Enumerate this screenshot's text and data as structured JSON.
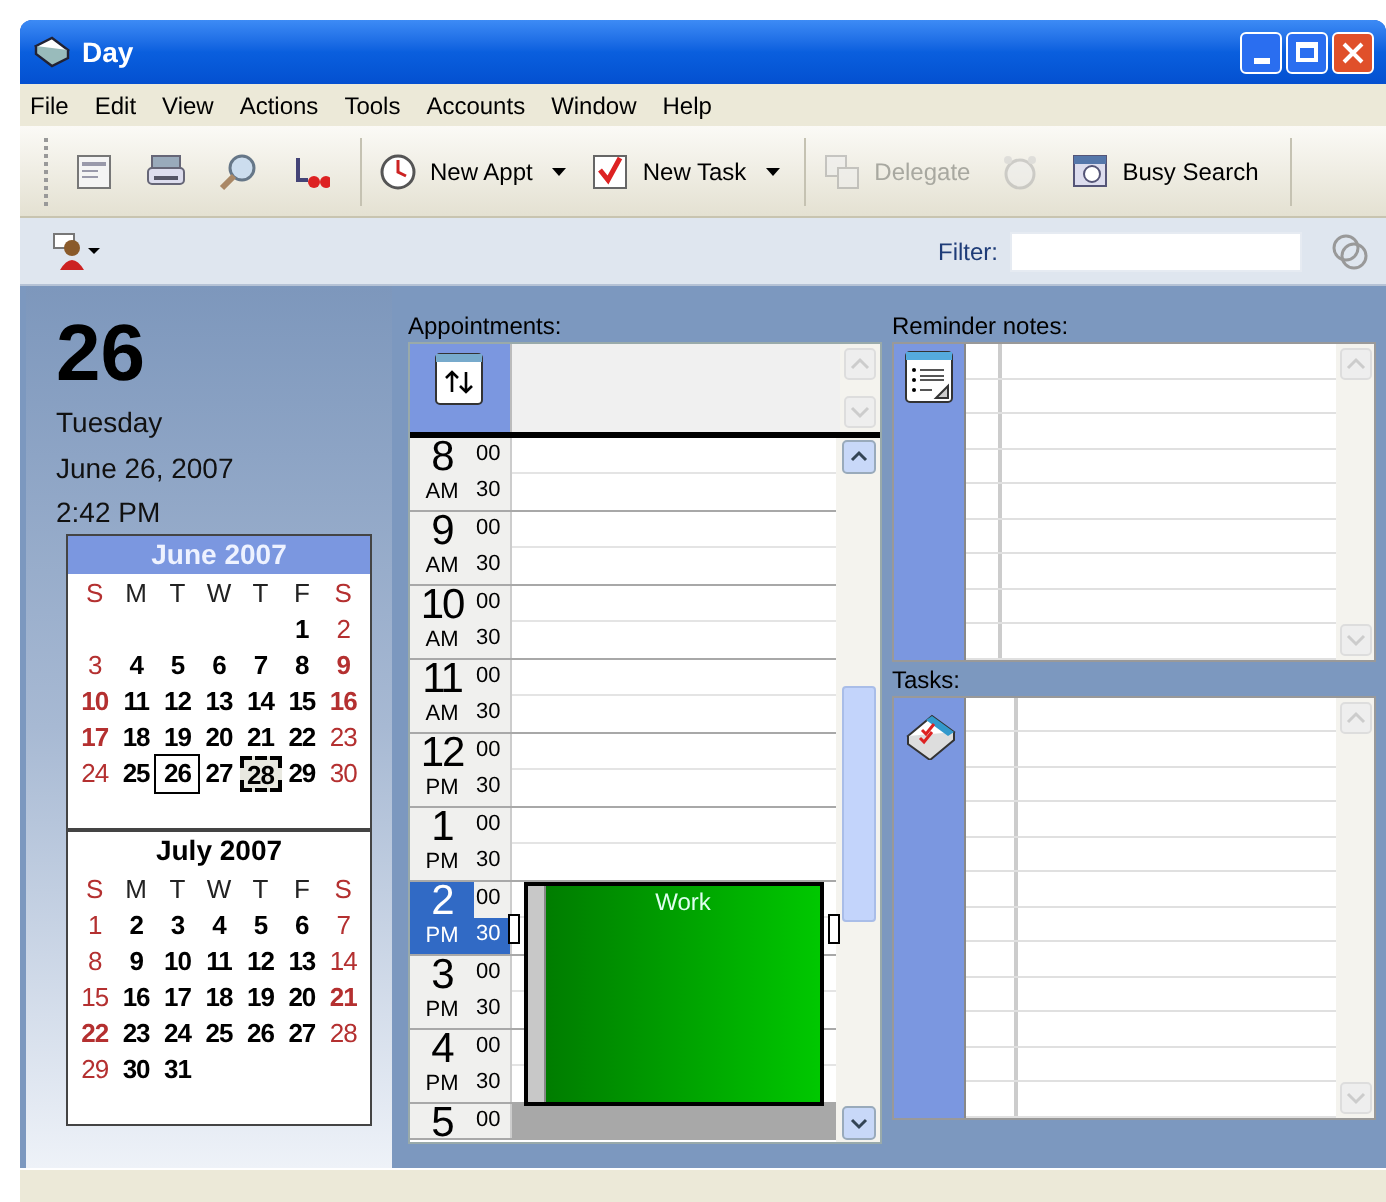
{
  "window": {
    "title": "Day"
  },
  "menu": [
    "File",
    "Edit",
    "View",
    "Actions",
    "Tools",
    "Accounts",
    "Window",
    "Help"
  ],
  "toolbar": [
    {
      "kind": "icon",
      "disabled": false
    },
    {
      "kind": "icon",
      "disabled": false
    },
    {
      "kind": "icon",
      "disabled": false
    },
    {
      "kind": "icon",
      "disabled": false
    },
    {
      "kind": "split",
      "label": "New Appt",
      "disabled": false
    },
    {
      "kind": "split",
      "label": "New Task",
      "disabled": false
    },
    {
      "kind": "text",
      "label": "Delegate",
      "disabled": true
    },
    {
      "kind": "icon",
      "disabled": true
    },
    {
      "kind": "text",
      "label": "Busy Search",
      "disabled": false
    }
  ],
  "filter": {
    "label": "Filter:"
  },
  "today": {
    "day": "26",
    "weekday": "Tuesday",
    "date": "June 26, 2007",
    "time": "2:42 PM"
  },
  "calendars": [
    {
      "title": "June 2007",
      "current": true,
      "weekdays": [
        "S",
        "M",
        "T",
        "W",
        "T",
        "F",
        "S"
      ],
      "weeks": [
        [
          {
            "day": "1",
            "bold": true,
            "today": false,
            "selected": false
          },
          {
            "day": "2",
            "bold": false,
            "today": false,
            "selected": false
          }
        ],
        [
          {
            "day": "3",
            "bold": false,
            "today": false,
            "selected": false
          },
          {
            "day": "4",
            "bold": true,
            "today": false,
            "selected": false
          },
          {
            "day": "5",
            "bold": true,
            "today": false,
            "selected": false
          },
          {
            "day": "6",
            "bold": true,
            "today": false,
            "selected": false
          },
          {
            "day": "7",
            "bold": true,
            "today": false,
            "selected": false
          },
          {
            "day": "8",
            "bold": true,
            "today": false,
            "selected": false
          },
          {
            "day": "9",
            "bold": true,
            "today": false,
            "selected": false
          }
        ],
        [
          {
            "day": "10",
            "bold": true,
            "today": false,
            "selected": false
          },
          {
            "day": "11",
            "bold": true,
            "today": false,
            "selected": false
          },
          {
            "day": "12",
            "bold": true,
            "today": false,
            "selected": false
          },
          {
            "day": "13",
            "bold": true,
            "today": false,
            "selected": false
          },
          {
            "day": "14",
            "bold": true,
            "today": false,
            "selected": false
          },
          {
            "day": "15",
            "bold": true,
            "today": false,
            "selected": false
          },
          {
            "day": "16",
            "bold": true,
            "today": false,
            "selected": false
          }
        ],
        [
          {
            "day": "17",
            "bold": true,
            "today": false,
            "selected": false
          },
          {
            "day": "18",
            "bold": true,
            "today": false,
            "selected": false
          },
          {
            "day": "19",
            "bold": true,
            "today": false,
            "selected": false
          },
          {
            "day": "20",
            "bold": true,
            "today": false,
            "selected": false
          },
          {
            "day": "21",
            "bold": true,
            "today": false,
            "selected": false
          },
          {
            "day": "22",
            "bold": true,
            "today": false,
            "selected": false
          },
          {
            "day": "23",
            "bold": false,
            "today": false,
            "selected": false
          }
        ],
        [
          {
            "day": "24",
            "bold": false,
            "today": false,
            "selected": false
          },
          {
            "day": "25",
            "bold": true,
            "today": false,
            "selected": false
          },
          {
            "day": "26",
            "bold": true,
            "today": true,
            "selected": false
          },
          {
            "day": "27",
            "bold": true,
            "today": false,
            "selected": false
          },
          {
            "day": "28",
            "bold": true,
            "today": false,
            "selected": true
          },
          {
            "day": "29",
            "bold": true,
            "today": false,
            "selected": false
          },
          {
            "day": "30",
            "bold": false,
            "today": false,
            "selected": false
          }
        ]
      ]
    },
    {
      "title": "July 2007",
      "current": false,
      "weekdays": [
        "S",
        "M",
        "T",
        "W",
        "T",
        "F",
        "S"
      ],
      "weeks": [
        [
          {
            "day": "1",
            "bold": false,
            "today": false,
            "selected": false
          },
          {
            "day": "2",
            "bold": true,
            "today": false,
            "selected": false
          },
          {
            "day": "3",
            "bold": true,
            "today": false,
            "selected": false
          },
          {
            "day": "4",
            "bold": true,
            "today": false,
            "selected": false
          },
          {
            "day": "5",
            "bold": true,
            "today": false,
            "selected": false
          },
          {
            "day": "6",
            "bold": true,
            "today": false,
            "selected": false
          },
          {
            "day": "7",
            "bold": false,
            "today": false,
            "selected": false
          }
        ],
        [
          {
            "day": "8",
            "bold": false,
            "today": false,
            "selected": false
          },
          {
            "day": "9",
            "bold": true,
            "today": false,
            "selected": false
          },
          {
            "day": "10",
            "bold": true,
            "today": false,
            "selected": false
          },
          {
            "day": "11",
            "bold": true,
            "today": false,
            "selected": false
          },
          {
            "day": "12",
            "bold": true,
            "today": false,
            "selected": false
          },
          {
            "day": "13",
            "bold": true,
            "today": false,
            "selected": false
          },
          {
            "day": "14",
            "bold": false,
            "today": false,
            "selected": false
          }
        ],
        [
          {
            "day": "15",
            "bold": false,
            "today": false,
            "selected": false
          },
          {
            "day": "16",
            "bold": true,
            "today": false,
            "selected": false
          },
          {
            "day": "17",
            "bold": true,
            "today": false,
            "selected": false
          },
          {
            "day": "18",
            "bold": true,
            "today": false,
            "selected": false
          },
          {
            "day": "19",
            "bold": true,
            "today": false,
            "selected": false
          },
          {
            "day": "20",
            "bold": true,
            "today": false,
            "selected": false
          },
          {
            "day": "21",
            "bold": true,
            "today": false,
            "selected": false
          }
        ],
        [
          {
            "day": "22",
            "bold": true,
            "today": false,
            "selected": false
          },
          {
            "day": "23",
            "bold": true,
            "today": false,
            "selected": false
          },
          {
            "day": "24",
            "bold": true,
            "today": false,
            "selected": false
          },
          {
            "day": "25",
            "bold": true,
            "today": false,
            "selected": false
          },
          {
            "day": "26",
            "bold": true,
            "today": false,
            "selected": false
          },
          {
            "day": "27",
            "bold": true,
            "today": false,
            "selected": false
          },
          {
            "day": "28",
            "bold": false,
            "today": false,
            "selected": false
          }
        ],
        [
          {
            "day": "29",
            "bold": false,
            "today": false,
            "selected": false
          },
          {
            "day": "30",
            "bold": true,
            "today": false,
            "selected": false
          },
          {
            "day": "31",
            "bold": true,
            "today": false,
            "selected": false
          }
        ]
      ]
    }
  ],
  "appointments": {
    "label": "Appointments:",
    "hours": [
      {
        "hour": "8",
        "ampm": "AM",
        "selected": false,
        "off_hours": false,
        "slots": [
          {
            "minute": "00",
            "selected": false
          },
          {
            "minute": "30",
            "selected": false
          }
        ]
      },
      {
        "hour": "9",
        "ampm": "AM",
        "selected": false,
        "off_hours": false,
        "slots": [
          {
            "minute": "00",
            "selected": false
          },
          {
            "minute": "30",
            "selected": false
          }
        ]
      },
      {
        "hour": "10",
        "ampm": "AM",
        "selected": false,
        "off_hours": false,
        "slots": [
          {
            "minute": "00",
            "selected": false
          },
          {
            "minute": "30",
            "selected": false
          }
        ]
      },
      {
        "hour": "11",
        "ampm": "AM",
        "selected": false,
        "off_hours": false,
        "slots": [
          {
            "minute": "00",
            "selected": false
          },
          {
            "minute": "30",
            "selected": false
          }
        ]
      },
      {
        "hour": "12",
        "ampm": "PM",
        "selected": false,
        "off_hours": false,
        "slots": [
          {
            "minute": "00",
            "selected": false
          },
          {
            "minute": "30",
            "selected": false
          }
        ]
      },
      {
        "hour": "1",
        "ampm": "PM",
        "selected": false,
        "off_hours": false,
        "slots": [
          {
            "minute": "00",
            "selected": false
          },
          {
            "minute": "30",
            "selected": false
          }
        ]
      },
      {
        "hour": "2",
        "ampm": "PM",
        "selected": true,
        "off_hours": false,
        "slots": [
          {
            "minute": "00",
            "selected": false
          },
          {
            "minute": "30",
            "selected": true
          }
        ]
      },
      {
        "hour": "3",
        "ampm": "PM",
        "selected": false,
        "off_hours": false,
        "slots": [
          {
            "minute": "00",
            "selected": false
          },
          {
            "minute": "30",
            "selected": false
          }
        ]
      },
      {
        "hour": "4",
        "ampm": "PM",
        "selected": false,
        "off_hours": false,
        "slots": [
          {
            "minute": "00",
            "selected": false
          },
          {
            "minute": "30",
            "selected": false
          }
        ]
      },
      {
        "hour": "5",
        "selected": false,
        "off_hours": true,
        "slots": [
          {
            "minute": "00",
            "selected": false
          }
        ]
      }
    ],
    "items": [
      {
        "title": "Work"
      }
    ]
  },
  "reminders": {
    "label": "Reminder notes:"
  },
  "tasks": {
    "label": "Tasks:"
  }
}
